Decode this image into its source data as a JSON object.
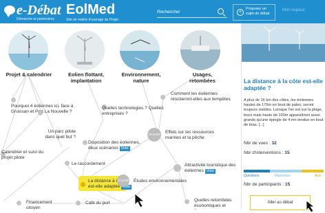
{
  "header": {
    "logo_edebat": {
      "title": "e-Débat",
      "subtitle": "Démarche et partenaires"
    },
    "logo_eolmed": {
      "title": "EolMed",
      "subtitle": "Site de maître d'ouvrage du Projet"
    },
    "search": {
      "placeholder": "Rechercher"
    },
    "propose": {
      "label": "Proposer un sujet de débat"
    },
    "myspace": "Mon espace"
  },
  "categories": [
    {
      "label": "Projet & calendrier"
    },
    {
      "label": "Eolien flottant, implantation"
    },
    {
      "label": "Environnement, nature"
    },
    {
      "label": "Usages, retombées"
    }
  ],
  "nodes": {
    "pourquoi": "Pourquoi 4 éoliennes ici, face à Gruissan et Port La Nouvelle ?",
    "parc_pilote": "Un parc pilote dans quel but ?",
    "calendrier": "Calendrier et suivi du projet pilote",
    "financement": "Financement citoyen",
    "technologies": "Quelles technologies ? Quelles entreprises ?",
    "disposition": "Disposition des éoliennes, deux scénarios",
    "raccordement": "Le raccordement",
    "distance": "La distance à la côte est-elle adaptée",
    "resistance": "Comment les éoliennes résisteront-elles aux tempêtes",
    "effets": "Effets sur les ressources marines et la pêche",
    "etudes": "Études environnementales",
    "attractivite": "Attractivité touristique des éoliennes",
    "cafe": "Café du port",
    "retombees": "Quelles retombées économiques et fiscales",
    "vote": "Vote",
    "big_dot_label": "15 posts",
    "big_dot_label2": "11 posts"
  },
  "panel": {
    "title": "La distance à la côte est-elle adaptée ?",
    "text": "A plus de 16 km des côtes, les éoliennes hautes de 176m en bout de pales, seront toujours visibles. Lorsque l'on est sur la plage, leurs mats hauts de 100m apparaîtront aussi grands qu'une épingle de 4 mn tendue en bout de bras. [...]",
    "views_label": "Nbr de vues : ",
    "views": "32",
    "interventions_label": "Nbr d'interventions : ",
    "interventions": "15",
    "bar_labels": {
      "questions": "Questions",
      "reponses": "Réponses",
      "avis": "Avis"
    },
    "participants_label": "Nbr de participants : ",
    "participants": "15",
    "debate_button": "Aller au débat"
  },
  "colors": {
    "header_blue": "#1f8fcf",
    "title_blue": "#1f7fbf",
    "highlight_yellow": "#f5e63a"
  }
}
